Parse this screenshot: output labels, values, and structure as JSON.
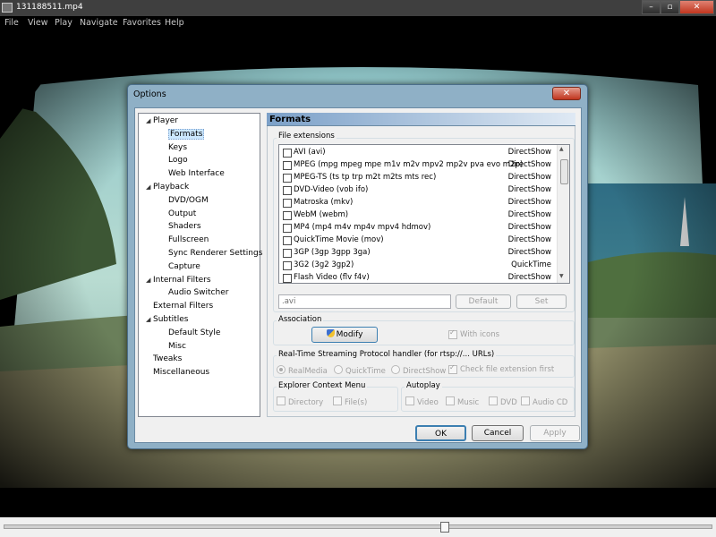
{
  "window": {
    "title": "131188511.mp4",
    "minimize": "–",
    "maximize": "▫",
    "close": "✕"
  },
  "menu": [
    "File",
    "View",
    "Play",
    "Navigate",
    "Favorites",
    "Help"
  ],
  "dialog": {
    "title": "Options",
    "close": "✕",
    "tree": [
      {
        "label": "Player",
        "level": 0,
        "expander": "◢"
      },
      {
        "label": "Formats",
        "level": 1,
        "selected": true
      },
      {
        "label": "Keys",
        "level": 1
      },
      {
        "label": "Logo",
        "level": 1
      },
      {
        "label": "Web Interface",
        "level": 1
      },
      {
        "label": "Playback",
        "level": 0,
        "expander": "◢"
      },
      {
        "label": "DVD/OGM",
        "level": 1
      },
      {
        "label": "Output",
        "level": 1
      },
      {
        "label": "Shaders",
        "level": 1
      },
      {
        "label": "Fullscreen",
        "level": 1
      },
      {
        "label": "Sync Renderer Settings",
        "level": 1
      },
      {
        "label": "Capture",
        "level": 1
      },
      {
        "label": "Internal Filters",
        "level": 0,
        "expander": "◢"
      },
      {
        "label": "Audio Switcher",
        "level": 1
      },
      {
        "label": "External Filters",
        "level": 0
      },
      {
        "label": "Subtitles",
        "level": 0,
        "expander": "◢"
      },
      {
        "label": "Default Style",
        "level": 1
      },
      {
        "label": "Misc",
        "level": 1
      },
      {
        "label": "Tweaks",
        "level": 0
      },
      {
        "label": "Miscellaneous",
        "level": 0
      }
    ],
    "panel_title": "Formats",
    "file_extensions": {
      "label": "File extensions",
      "items": [
        {
          "name": "AVI (avi)",
          "source": "DirectShow"
        },
        {
          "name": "MPEG (mpg mpeg mpe m1v m2v mpv2 mp2v pva evo m2p)",
          "source": "DirectShow"
        },
        {
          "name": "MPEG-TS (ts tp trp m2t m2ts mts rec)",
          "source": "DirectShow"
        },
        {
          "name": "DVD-Video (vob ifo)",
          "source": "DirectShow"
        },
        {
          "name": "Matroska (mkv)",
          "source": "DirectShow"
        },
        {
          "name": "WebM (webm)",
          "source": "DirectShow"
        },
        {
          "name": "MP4 (mp4 m4v mp4v mpv4 hdmov)",
          "source": "DirectShow"
        },
        {
          "name": "QuickTime Movie (mov)",
          "source": "DirectShow"
        },
        {
          "name": "3GP (3gp 3gpp 3ga)",
          "source": "DirectShow"
        },
        {
          "name": "3G2 (3g2 3gp2)",
          "source": "QuickTime"
        },
        {
          "name": "Flash Video (flv f4v)",
          "source": "DirectShow"
        }
      ],
      "ext_value": ".avi",
      "default_btn": "Default",
      "set_btn": "Set"
    },
    "association": {
      "label": "Association",
      "modify_btn": "Modify",
      "with_icons": "With icons"
    },
    "rtsp": {
      "label": "Real-Time Streaming Protocol handler (for rtsp://... URLs)",
      "options": [
        "RealMedia",
        "QuickTime",
        "DirectShow"
      ],
      "check_ext": "Check file extension first"
    },
    "context_menu": {
      "label": "Explorer Context Menu",
      "directory": "Directory",
      "files": "File(s)"
    },
    "autoplay": {
      "label": "Autoplay",
      "video": "Video",
      "music": "Music",
      "dvd": "DVD",
      "audio_cd": "Audio CD"
    },
    "ok": "OK",
    "cancel": "Cancel",
    "apply": "Apply"
  }
}
